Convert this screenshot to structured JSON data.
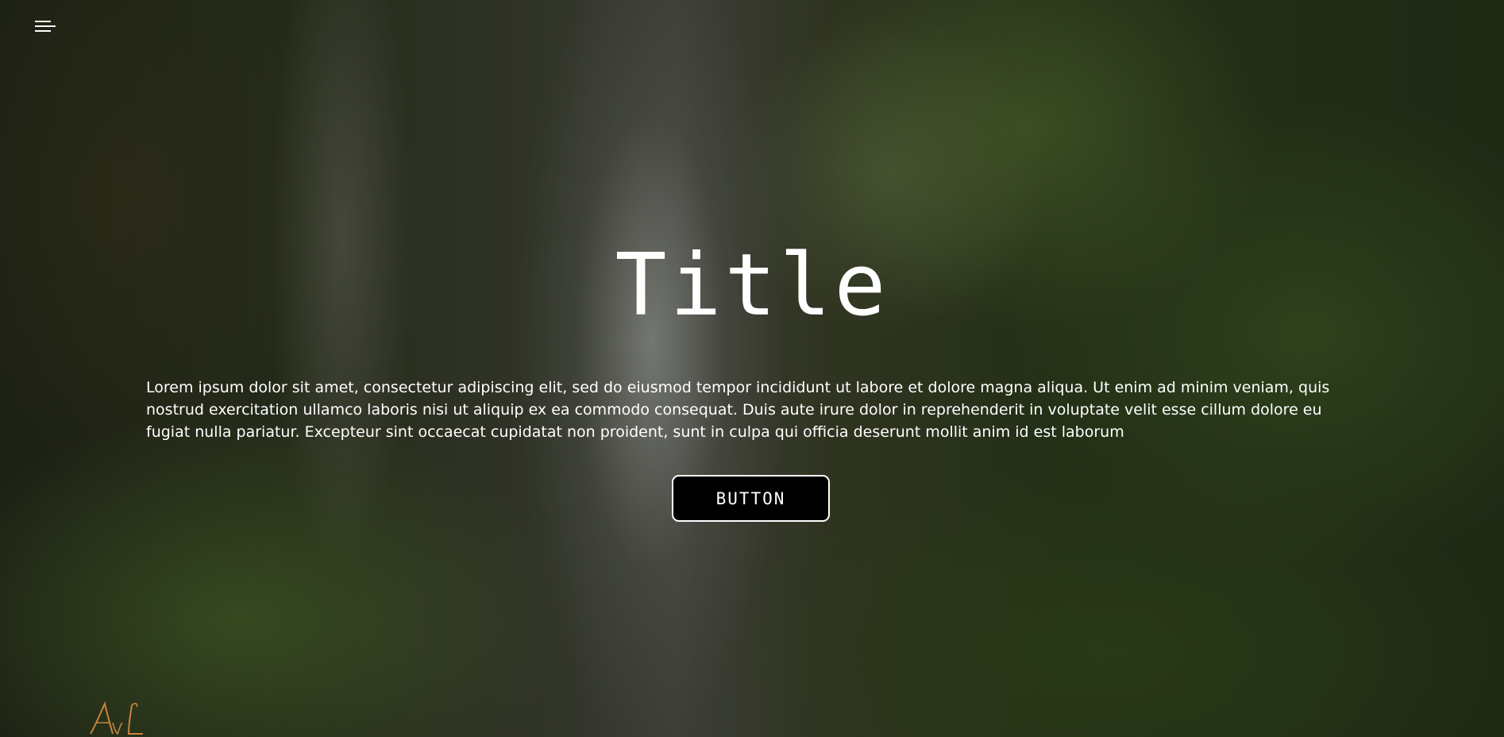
{
  "nav": {
    "menu_icon": "hamburger-menu-icon"
  },
  "hero": {
    "title": "Title",
    "body": "Lorem ipsum dolor sit amet, consectetur adipiscing elit, sed do eiusmod tempor incididunt ut labore et dolore magna aliqua. Ut enim ad minim veniam, quis nostrud exercitation ullamco laboris nisi ut aliquip ex ea commodo consequat. Duis aute irure dolor in reprehenderit in voluptate velit esse cillum dolore eu fugiat nulla pariatur. Excepteur sint occaecat cupidatat non proident, sunt in culpa qui officia deserunt mollit anim id est laborum",
    "button_label": "BUTTON",
    "background": "jungle-waterfall-photo"
  },
  "logo": {
    "text": "AvL",
    "color": "#c8843c"
  },
  "colors": {
    "text": "#ffffff",
    "button_bg": "#000000",
    "button_border": "#ffffff"
  }
}
